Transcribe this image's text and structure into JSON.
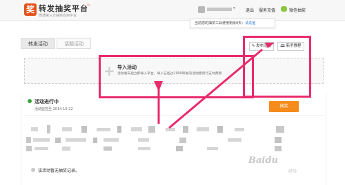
{
  "logo": {
    "glyph": "奖",
    "title": "转发抽奖平台",
    "subtitle": "微博第三方抽奖应用平台"
  },
  "user_menu": {
    "caret": "▾"
  },
  "nav": {
    "logout": "退出",
    "service": "服务充值",
    "wechat": "微信抽奖"
  },
  "tooltip": {
    "text": "当前您的抽奖工具使用剩余0天：",
    "link": "请充值"
  },
  "tabs": [
    {
      "label": "转发活动",
      "active": true
    },
    {
      "label": "话题活动",
      "active": false
    }
  ],
  "actions": {
    "publish": "✎ 发布活动",
    "tutorial": "🕮 新手教程"
  },
  "import": {
    "title": "导入活动",
    "description": "活动发布后立即导入平台，导入已超过2000转发的活动需另行支付费用"
  },
  "activity": {
    "status_title": "活动进行中",
    "date_label": "活动监控至",
    "date": "2014-10-22",
    "lottery_button": "抽奖",
    "no_record": "该活动暂无抽奖记录。"
  },
  "watermark": {
    "brand": "Baidu",
    "sub": "经验"
  },
  "colors": {
    "accent": "#e92a6b",
    "button": "#f58c1b",
    "status_dot": "#36a737",
    "link": "#1e6fcf"
  }
}
